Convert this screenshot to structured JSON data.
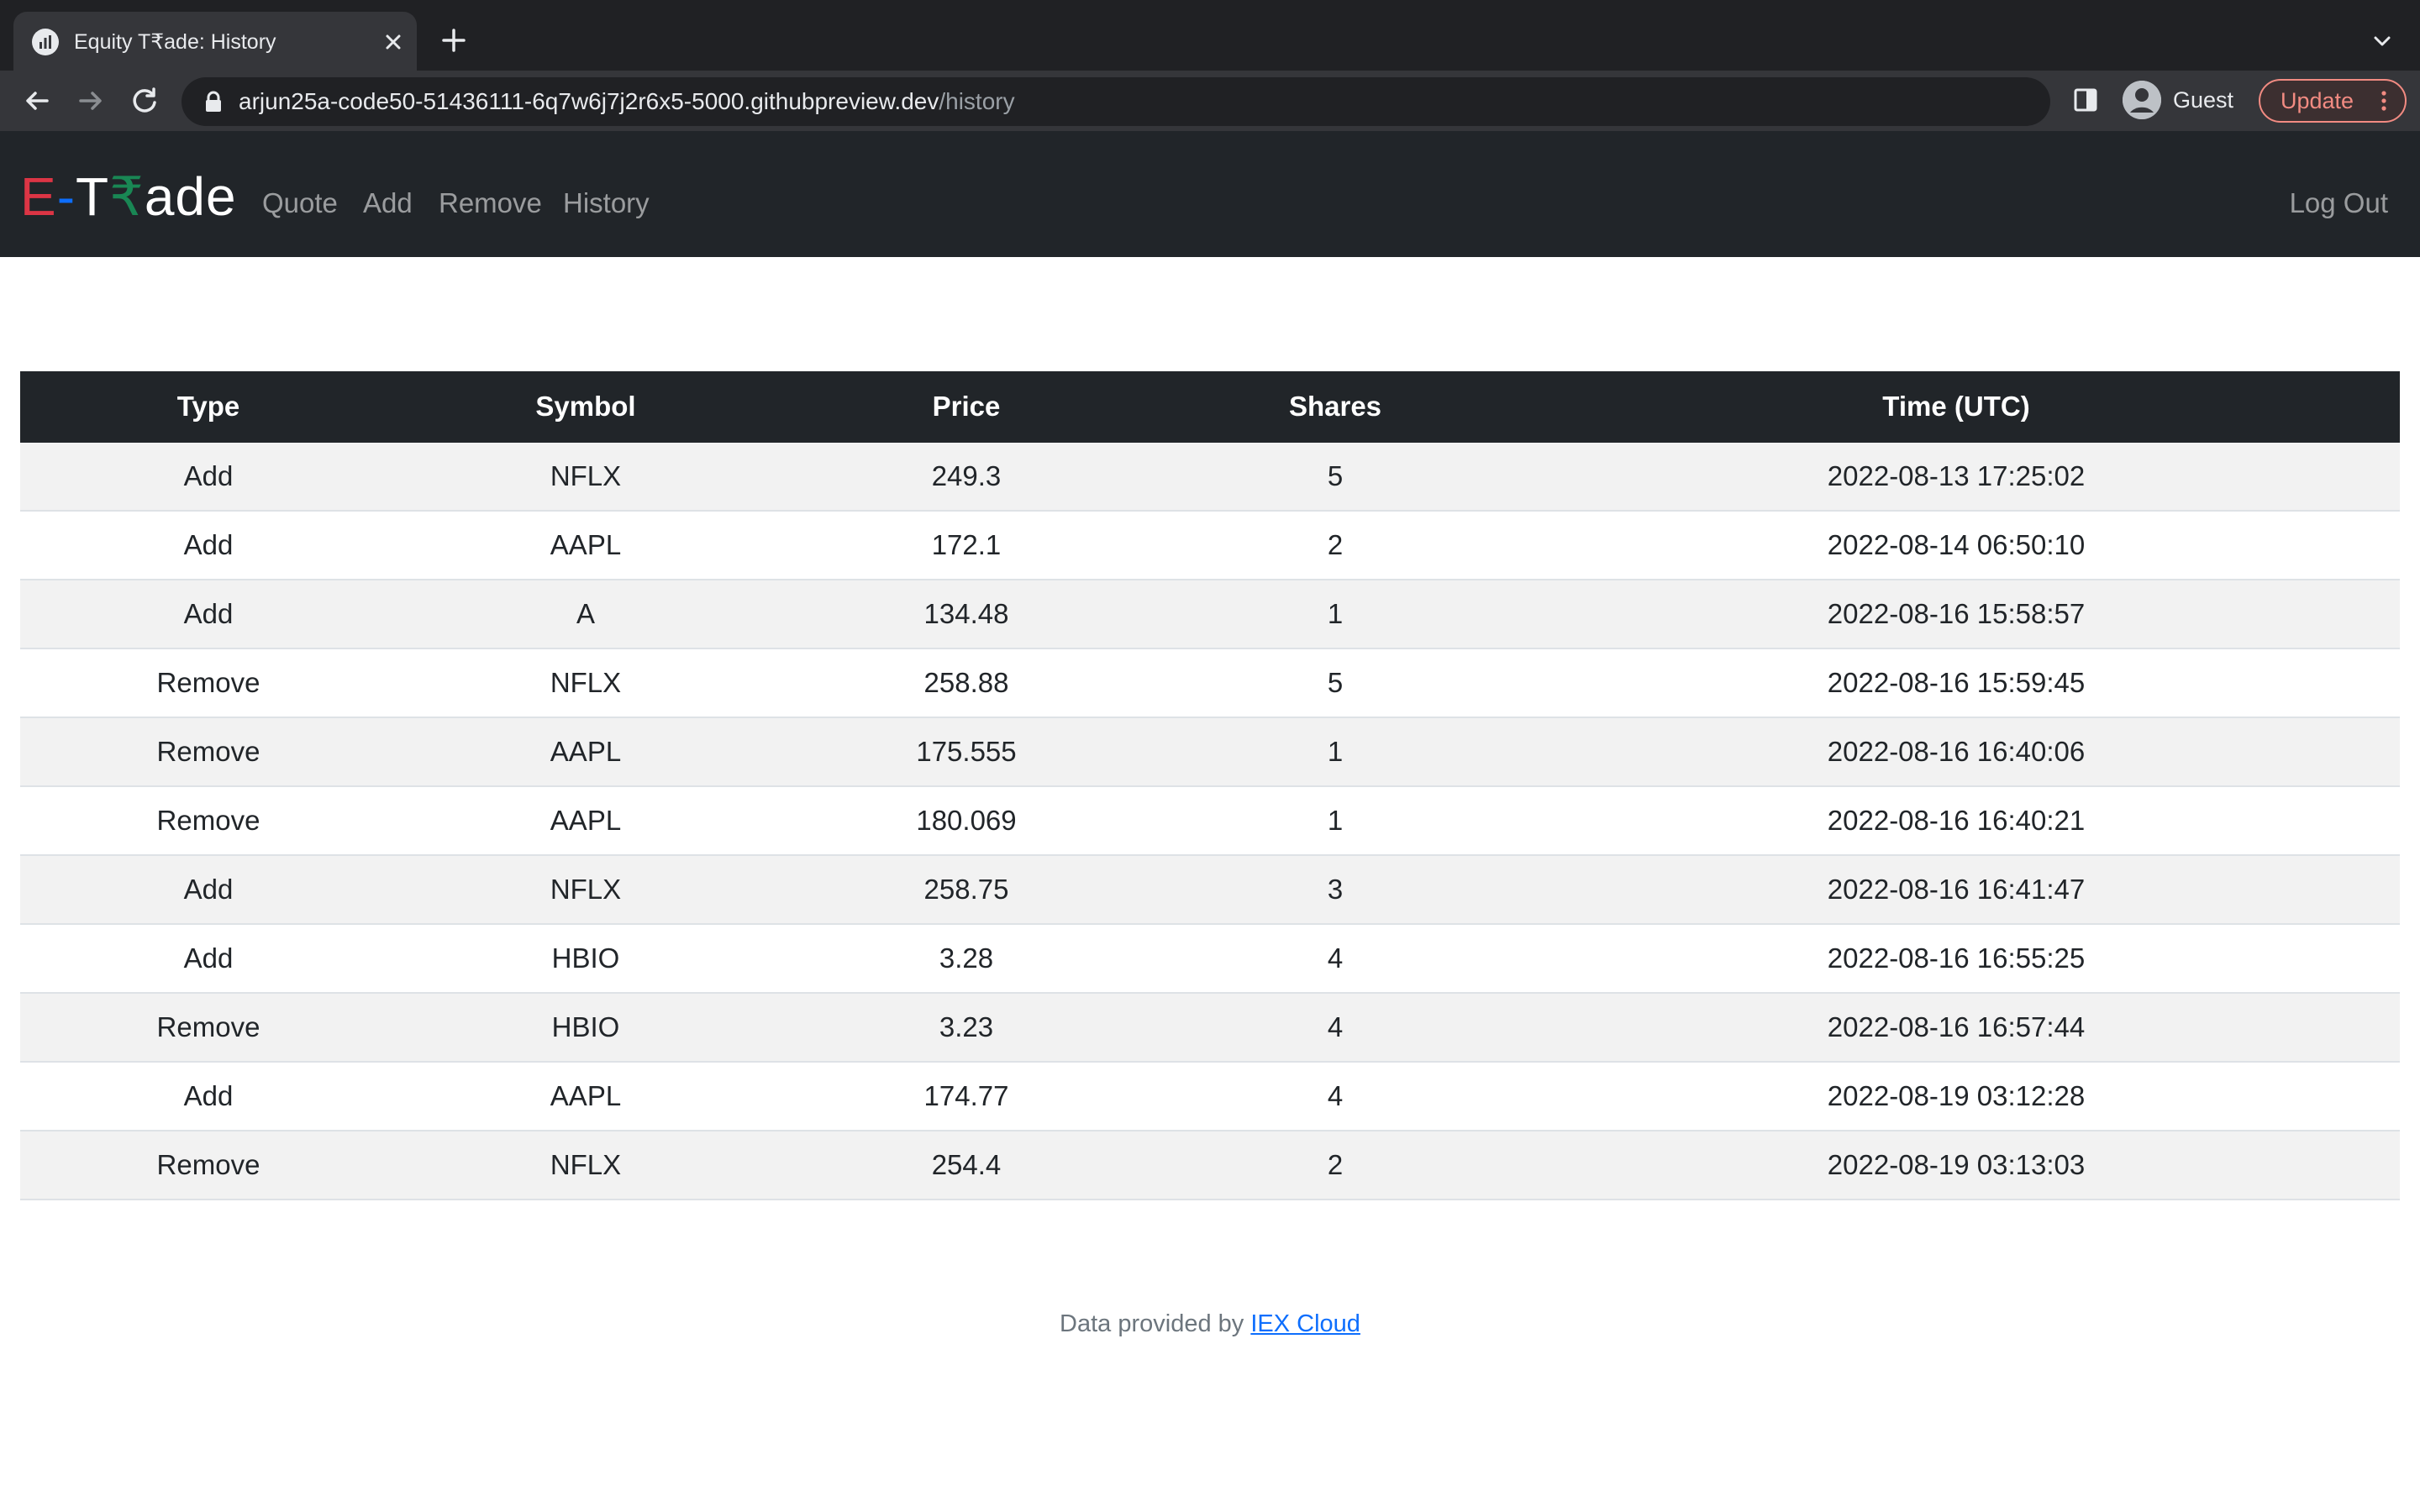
{
  "browser": {
    "tab_title": "Equity T₹ade: History",
    "url_host": "arjun25a-code50-51436111-6q7w6j7j2r6x5-5000.githubpreview.dev",
    "url_path": "/history",
    "profile_label": "Guest",
    "update_label": "Update"
  },
  "brand": {
    "e": "E",
    "dash": "-",
    "t": "T",
    "rupee": "₹",
    "ade": "ade"
  },
  "nav": {
    "quote": "Quote",
    "add": "Add",
    "remove": "Remove",
    "history": "History",
    "logout": "Log Out"
  },
  "table": {
    "headers": [
      "Type",
      "Symbol",
      "Price",
      "Shares",
      "Time (UTC)"
    ],
    "rows": [
      {
        "type": "Add",
        "symbol": "NFLX",
        "price": "249.3",
        "shares": "5",
        "time": "2022-08-13 17:25:02"
      },
      {
        "type": "Add",
        "symbol": "AAPL",
        "price": "172.1",
        "shares": "2",
        "time": "2022-08-14 06:50:10"
      },
      {
        "type": "Add",
        "symbol": "A",
        "price": "134.48",
        "shares": "1",
        "time": "2022-08-16 15:58:57"
      },
      {
        "type": "Remove",
        "symbol": "NFLX",
        "price": "258.88",
        "shares": "5",
        "time": "2022-08-16 15:59:45"
      },
      {
        "type": "Remove",
        "symbol": "AAPL",
        "price": "175.555",
        "shares": "1",
        "time": "2022-08-16 16:40:06"
      },
      {
        "type": "Remove",
        "symbol": "AAPL",
        "price": "180.069",
        "shares": "1",
        "time": "2022-08-16 16:40:21"
      },
      {
        "type": "Add",
        "symbol": "NFLX",
        "price": "258.75",
        "shares": "3",
        "time": "2022-08-16 16:41:47"
      },
      {
        "type": "Add",
        "symbol": "HBIO",
        "price": "3.28",
        "shares": "4",
        "time": "2022-08-16 16:55:25"
      },
      {
        "type": "Remove",
        "symbol": "HBIO",
        "price": "3.23",
        "shares": "4",
        "time": "2022-08-16 16:57:44"
      },
      {
        "type": "Add",
        "symbol": "AAPL",
        "price": "174.77",
        "shares": "4",
        "time": "2022-08-19 03:12:28"
      },
      {
        "type": "Remove",
        "symbol": "NFLX",
        "price": "254.4",
        "shares": "2",
        "time": "2022-08-19 03:13:03"
      }
    ]
  },
  "footer": {
    "text": "Data provided by ",
    "link_label": "IEX Cloud"
  },
  "colors": {
    "navbar_bg": "#212529",
    "brand_e": "#dc3545",
    "brand_dash": "#0d6efd",
    "brand_rupee": "#198754",
    "striped_row": "#f2f2f2",
    "link": "#0d6efd"
  }
}
